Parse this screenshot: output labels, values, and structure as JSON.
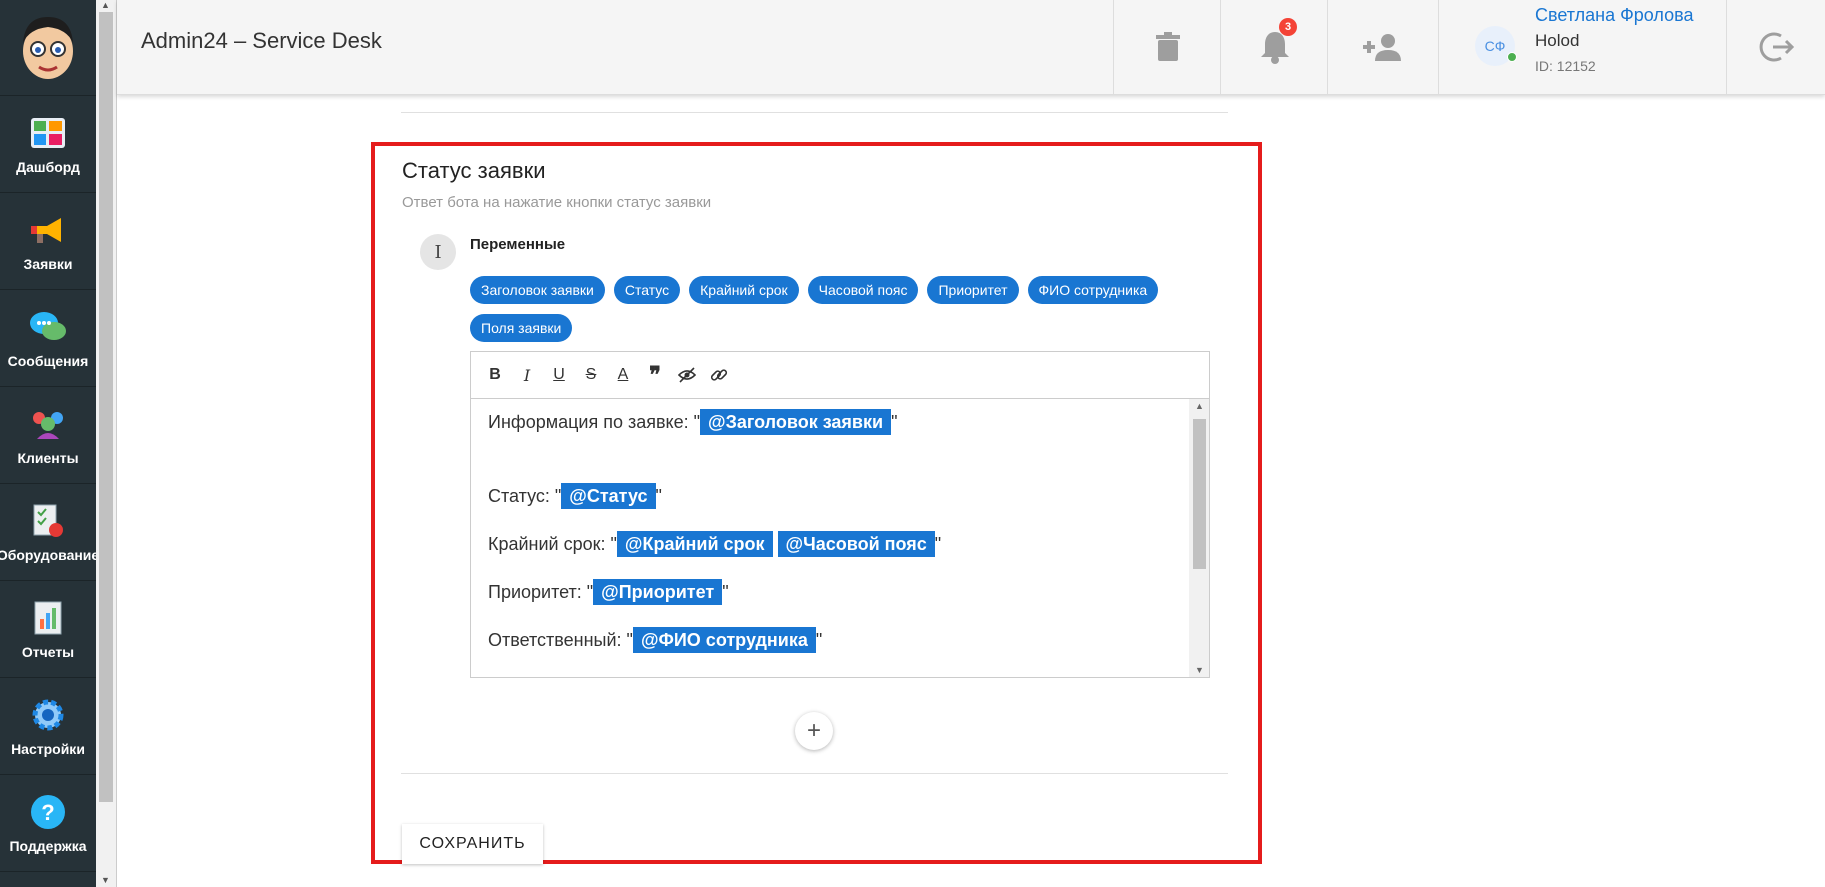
{
  "app": {
    "title": "Admin24 – Service Desk"
  },
  "sidebar": {
    "items": [
      {
        "label": "Дашборд",
        "icon": "dashboard-icon"
      },
      {
        "label": "Заявки",
        "icon": "megaphone-icon"
      },
      {
        "label": "Сообщения",
        "icon": "chat-icon"
      },
      {
        "label": "Клиенты",
        "icon": "clients-icon"
      },
      {
        "label": "Оборудование",
        "icon": "equipment-icon"
      },
      {
        "label": "Отчеты",
        "icon": "reports-icon"
      },
      {
        "label": "Настройки",
        "icon": "gear-icon"
      },
      {
        "label": "Поддержка",
        "icon": "help-icon"
      }
    ]
  },
  "header": {
    "notifications_count": "3",
    "user": {
      "initials": "СФ",
      "name": "Светлана Фролова",
      "company": "Holod",
      "id": "ID: 12152"
    }
  },
  "section": {
    "title": "Статус заявки",
    "subtitle": "Ответ бота на нажатие кнопки статус заявки",
    "variables_label": "Переменные",
    "chips": [
      "Заголовок заявки",
      "Статус",
      "Крайний срок",
      "Часовой пояс",
      "Приоритет",
      "ФИО сотрудника",
      "Поля заявки"
    ]
  },
  "editor": {
    "lines": [
      {
        "prefix": "Информация по заявке: \"",
        "tags": [
          "@Заголовок заявки"
        ],
        "suffix": "\""
      },
      {
        "prefix": "Статус: \"",
        "tags": [
          "@Статус"
        ],
        "suffix": "\""
      },
      {
        "prefix": "Крайний срок: \"",
        "tags": [
          "@Крайний срок",
          "@Часовой пояс"
        ],
        "suffix": "\""
      },
      {
        "prefix": "Приоритет: \"",
        "tags": [
          "@Приоритет"
        ],
        "suffix": "\""
      },
      {
        "prefix": "Ответственный: \"",
        "tags": [
          "@ФИО сотрудника"
        ],
        "suffix": "\""
      }
    ]
  },
  "actions": {
    "add": "+",
    "save_label": "СОХРАНИТЬ"
  },
  "colors": {
    "accent": "#1976d2",
    "highlight": "#e51c1c",
    "sidebar": "#263238"
  }
}
